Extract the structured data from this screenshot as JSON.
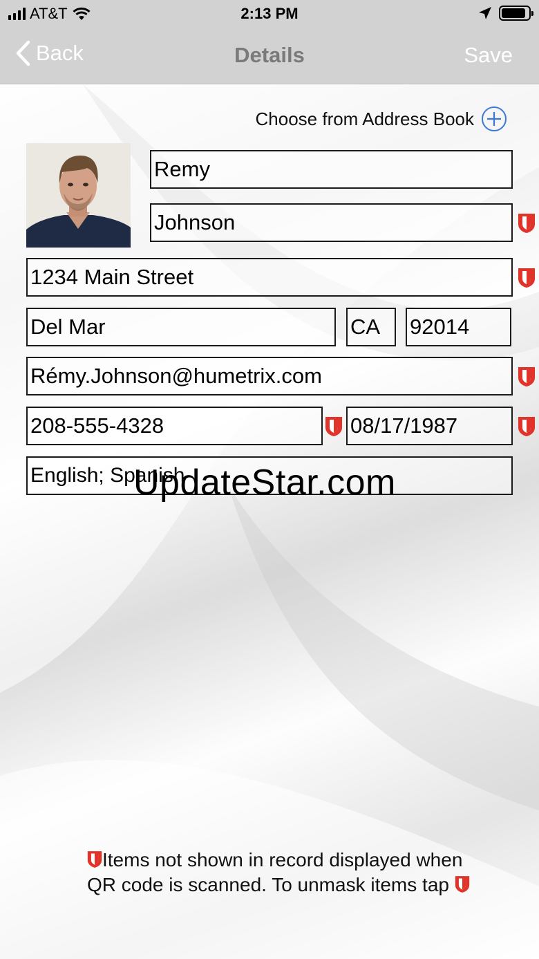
{
  "status_bar": {
    "carrier": "AT&T",
    "time": "2:13 PM",
    "battery_level": 0.9,
    "icons": [
      "signal-icon",
      "wifi-icon",
      "location-arrow-icon",
      "battery-icon"
    ]
  },
  "nav": {
    "back_label": "Back",
    "title": "Details",
    "save_label": "Save"
  },
  "address_book": {
    "label": "Choose from Address Book",
    "icon": "plus-circle-icon"
  },
  "form": {
    "first_name": "Remy",
    "last_name": "Johnson",
    "street": "1234 Main Street",
    "city": "Del Mar",
    "state": "CA",
    "zip": "92014",
    "email": "Rémy.Johnson@humetrix.com",
    "phone": "208-555-4328",
    "dob": "08/17/1987",
    "languages": "English; Spanish"
  },
  "watermark": "UpdateStar.com",
  "footnote": {
    "line1": "Items not shown in record displayed when QR code is scanned. To unmask items tap"
  },
  "colors": {
    "bar_bg": "#d2d2d2",
    "accent_blue": "#3b78d8",
    "mask_red": "#e0342a"
  }
}
